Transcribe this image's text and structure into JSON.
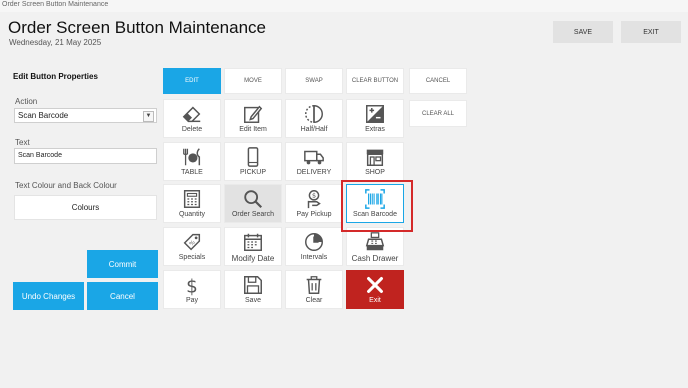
{
  "window": {
    "title": "Order Screen Button Maintenance"
  },
  "header": {
    "title": "Order Screen Button Maintenance",
    "date": "Wednesday, 21 May 2025",
    "save_label": "SAVE",
    "exit_label": "EXIT"
  },
  "panel": {
    "title": "Edit Button Properties",
    "action_label": "Action",
    "action_value": "Scan Barcode",
    "text_label": "Text",
    "text_value": "Scan Barcode",
    "colour_label": "Text Colour and Back Colour",
    "colours_button": "Colours",
    "commit_label": "Commit",
    "undo_label": "Undo Changes",
    "cancel_label": "Cancel"
  },
  "modes": {
    "edit": "EDIT",
    "move": "MOVE",
    "swap": "SWAP",
    "clear_button": "CLEAR BUTTON",
    "cancel": "CANCEL",
    "clear_all": "CLEAR ALL"
  },
  "grid": [
    {
      "label": "Delete",
      "icon": "eraser-icon"
    },
    {
      "label": "Edit Item",
      "icon": "edit-icon"
    },
    {
      "label": "Half/Half",
      "icon": "half-icon"
    },
    {
      "label": "Extras",
      "icon": "plus-minus-icon"
    },
    {
      "label": "TABLE",
      "icon": "dining-icon"
    },
    {
      "label": "PICKUP",
      "icon": "phone-icon"
    },
    {
      "label": "DELIVERY",
      "icon": "truck-icon"
    },
    {
      "label": "SHOP",
      "icon": "shop-icon"
    },
    {
      "label": "Quantity",
      "icon": "calculator-icon"
    },
    {
      "label": "Order Search",
      "icon": "search-icon"
    },
    {
      "label": "Pay Pickup",
      "icon": "hand-money-icon"
    },
    {
      "label": "Scan Barcode",
      "icon": "barcode-icon"
    },
    {
      "label": "Specials",
      "icon": "tag-icon"
    },
    {
      "label": "Modify Date",
      "icon": "calendar-icon"
    },
    {
      "label": "Intervals",
      "icon": "clock-icon"
    },
    {
      "label": "Cash Drawer",
      "icon": "cash-register-icon"
    },
    {
      "label": "Pay",
      "icon": "dollar-icon"
    },
    {
      "label": "Save",
      "icon": "floppy-icon"
    },
    {
      "label": "Clear",
      "icon": "trash-icon"
    },
    {
      "label": "Exit",
      "icon": "close-icon"
    }
  ],
  "colors": {
    "accent": "#1aa6e6",
    "exit_red": "#c0231f",
    "highlight": "#d42a2a"
  }
}
